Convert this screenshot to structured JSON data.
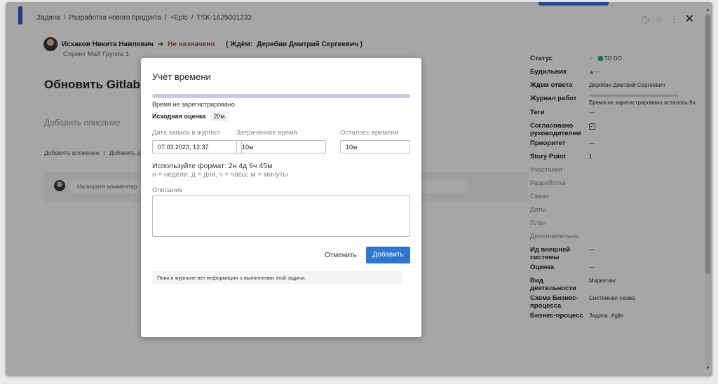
{
  "header": {
    "breadcrumb": [
      "Задача",
      "/",
      "Разработка нового продукта",
      "/",
      "+Epic",
      "/",
      "TSK-1625001233"
    ],
    "close_label": "✕"
  },
  "task": {
    "author": "Исхаков Никита Наилович",
    "arrow": "➔",
    "assignee": "Не назначено",
    "waiting_prefix": "( Ждём:",
    "waiting_person": "Дерябин Дмитрий Сергеевич )",
    "sprint": "Спринт Май Группа 1",
    "title": "Обновить Gitlab",
    "add_description": "Добавить описание",
    "add_attachment": "Добавить вложение",
    "separator": "|",
    "add_other": "Добавить д",
    "comment_placeholder": "Напишите комментар"
  },
  "properties": [
    {
      "label": "Статус",
      "value": "TO DO",
      "type": "status"
    },
    {
      "label": "Будильник",
      "value": "---",
      "type": "bell"
    },
    {
      "label": "Ждем ответа",
      "value": "Дерябин Дмитрий Сергеевич"
    },
    {
      "label": "Журнал работ",
      "value": "Время не зарегистрировано осталось 8ч",
      "type": "journal"
    },
    {
      "label": "Теги",
      "value": "---"
    },
    {
      "label": "Согласовано руководителем",
      "value": "✓",
      "type": "checkbox"
    },
    {
      "label": "Приоритет",
      "value": "—"
    },
    {
      "label": "Story Point",
      "value": "1"
    },
    {
      "label": "Участники",
      "value": "",
      "muted": true
    },
    {
      "label": "Разработка",
      "value": "",
      "muted": true
    },
    {
      "label": "Связи",
      "value": "",
      "muted": true
    },
    {
      "label": "Даты",
      "value": "",
      "muted": true
    },
    {
      "label": "План",
      "value": "",
      "muted": true
    },
    {
      "label": "Дополнительно",
      "value": "",
      "muted": true
    },
    {
      "label": "Ид внешней системы",
      "value": "—"
    },
    {
      "label": "Оценка",
      "value": "—"
    },
    {
      "label": "Вид деятельности",
      "value": "Маркетинг"
    },
    {
      "label": "Схема Бизнес-процесса",
      "value": "Системная схема"
    },
    {
      "label": "Бизнес-процесс",
      "value": "Задача. Agile"
    }
  ],
  "modal": {
    "title": "Учёт времени",
    "progress_fraction": 0,
    "no_time": "Время не зарегистрировано",
    "estimate_label": "Исходная оценка",
    "estimate_value": "20м",
    "date_label": "Дата записи в журнал",
    "date_value": "07.03.2023, 12:37",
    "spent_label": "Затраченное время",
    "spent_value": "10м",
    "remaining_label": "Осталось времени",
    "remaining_value": "10м",
    "format_hint": "Используйте формат: 2н 4д 6ч 45м",
    "format_sub": "н = недели, д = дни, ч = часы, м = минуты",
    "description_label": "Описание",
    "cancel_label": "Отменить",
    "add_label": "Добавить",
    "journal_empty": "Пока в журнале нет информации о выполнении этой задачи."
  },
  "colors": {
    "accent": "#2e77d0",
    "status": "#2aa9a0",
    "unassigned": "#c43b2f"
  }
}
